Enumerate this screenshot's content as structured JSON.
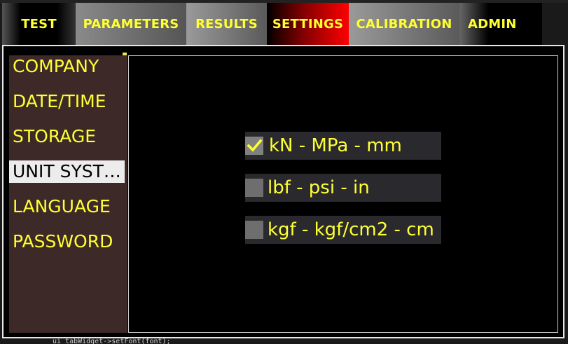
{
  "tabs": [
    {
      "label": "TEST"
    },
    {
      "label": "PARAMETERS"
    },
    {
      "label": "RESULTS"
    },
    {
      "label": "SETTINGS"
    },
    {
      "label": "CALIBRATION"
    },
    {
      "label": "ADMIN"
    }
  ],
  "active_tab": "SETTINGS",
  "sidebar": {
    "items": [
      {
        "label": "COMPANY"
      },
      {
        "label": "DATE/TIME"
      },
      {
        "label": "STORAGE"
      },
      {
        "label": "UNIT SYST…"
      },
      {
        "label": "LANGUAGE"
      },
      {
        "label": "PASSWORD"
      }
    ],
    "active_item": "UNIT SYST…"
  },
  "unit_systems": [
    {
      "label": "kN - MPa - mm",
      "checked": true
    },
    {
      "label": "lbf - psi - in",
      "checked": false
    },
    {
      "label": "kgf - kgf/cm2 - cm",
      "checked": false
    }
  ],
  "background_code": "ui_tabWidget->setFont(font);",
  "colors": {
    "text_accent": "#ffff33",
    "active_tab_red": "#ff0000",
    "sidebar_bg": "#3d2a28",
    "option_bg": "#2a2a2e"
  },
  "icons": {
    "checkmark": "check-icon"
  }
}
